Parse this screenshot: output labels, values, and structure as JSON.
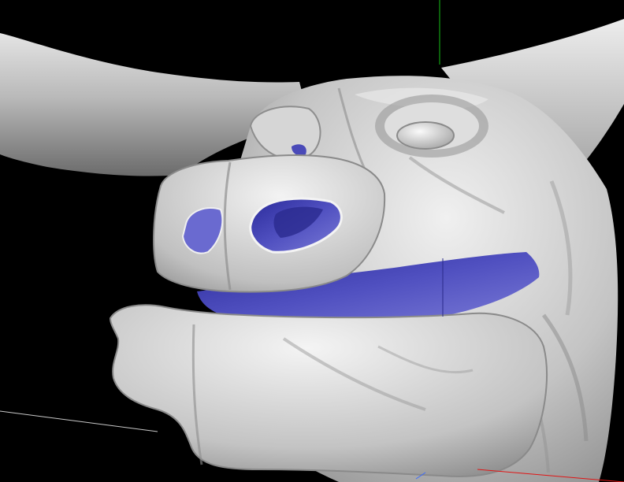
{
  "viewport": {
    "background_color": "#000000",
    "mesh_color": "#c9c9c9",
    "mesh_highlight_color": "#f2f2f2",
    "mesh_shadow_color": "#7d7d7d",
    "backface_color": "#4a4ab8",
    "backface_highlight_color": "#7f7fd8",
    "axis_x_color": "#e01515",
    "axis_y_color": "#18c018",
    "axis_z_color": "#c8c8c8",
    "axis_mark_color": "#3a6aff"
  }
}
